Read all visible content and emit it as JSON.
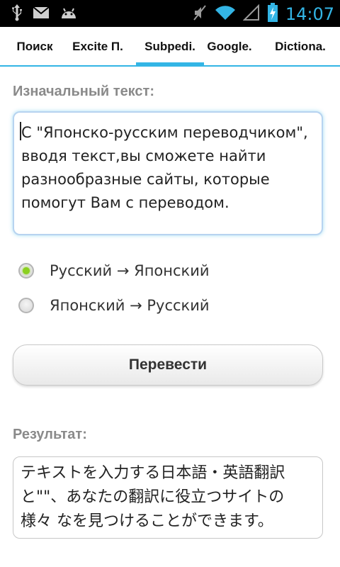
{
  "status_bar": {
    "time": "14:07",
    "left_icons": [
      "usb-icon",
      "mail-icon",
      "android-icon"
    ],
    "right_icons": [
      "mute-icon",
      "wifi-icon",
      "signal-icon",
      "battery-charging-icon"
    ]
  },
  "tabs": [
    {
      "label": "Поиск",
      "active": false
    },
    {
      "label": "Excite П.",
      "active": false
    },
    {
      "label": "Subpedi.",
      "active": true
    },
    {
      "label": "Google.",
      "active": false
    },
    {
      "label": "Dictiona.",
      "active": false
    }
  ],
  "source": {
    "label": "Изначальный текст:",
    "value": "С \"Японско-русским переводчиком\",\nвводя текст,вы сможете найти\nразнообразные сайты, которые\nпомогут Вам с переводом."
  },
  "direction": {
    "options": [
      {
        "label": "Русский → Японский",
        "checked": true
      },
      {
        "label": "Японский → Русский",
        "checked": false
      }
    ]
  },
  "translate_button": {
    "label": "Перевести"
  },
  "result": {
    "label": "Результат:",
    "value": "テキストを入力する日本語・英語翻訳\nと\"\"、あなたの翻訳に役立つサイトの\n様々 なを見つけることができます。"
  },
  "colors": {
    "accent": "#33b5e5",
    "radio_checked": "#8bd020",
    "label_gray": "#8a8a8a"
  }
}
